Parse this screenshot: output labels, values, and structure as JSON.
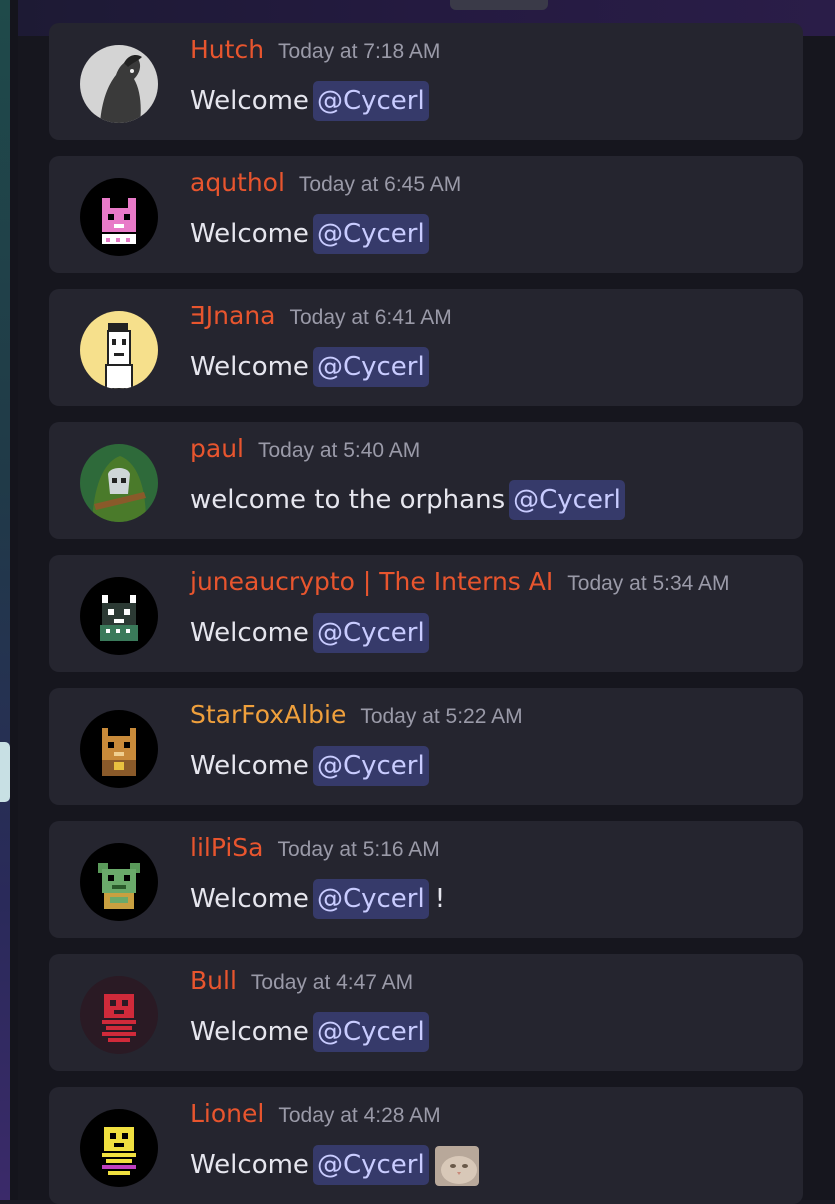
{
  "messages": [
    {
      "username": "Hutch",
      "timestamp": "Today at 7:18 AM",
      "text": "Welcome",
      "mention": "@Cycerl",
      "suffix": ""
    },
    {
      "username": "aquthol",
      "timestamp": "Today at 6:45 AM",
      "text": "Welcome",
      "mention": "@Cycerl",
      "suffix": ""
    },
    {
      "username": "ƎJnana",
      "timestamp": "Today at 6:41 AM",
      "text": "Welcome",
      "mention": "@Cycerl",
      "suffix": ""
    },
    {
      "username": "paul",
      "timestamp": "Today at 5:40 AM",
      "text": "welcome to the orphans",
      "mention": "@Cycerl",
      "suffix": ""
    },
    {
      "username": "juneaucrypto | The Interns AI",
      "timestamp": "Today at 5:34 AM",
      "text": "Welcome",
      "mention": "@Cycerl",
      "suffix": ""
    },
    {
      "username": "StarFoxAlbie",
      "timestamp": "Today at 5:22 AM",
      "text": "Welcome",
      "mention": "@Cycerl",
      "suffix": ""
    },
    {
      "username": "lilPiSa",
      "timestamp": "Today at 5:16 AM",
      "text": "Welcome",
      "mention": "@Cycerl",
      "suffix": "!"
    },
    {
      "username": "Bull",
      "timestamp": "Today at 4:47 AM",
      "text": "Welcome",
      "mention": "@Cycerl",
      "suffix": ""
    },
    {
      "username": "Lionel",
      "timestamp": "Today at 4:28 AM",
      "text": "Welcome",
      "mention": "@Cycerl",
      "suffix": ""
    }
  ],
  "colors": {
    "username": "#e8552e",
    "username_alt": "#f0a03c",
    "mention_bg": "#363a6a",
    "mention_text": "#c9ccff",
    "card_bg": "#25252f",
    "timestamp": "#9a9aa8"
  }
}
